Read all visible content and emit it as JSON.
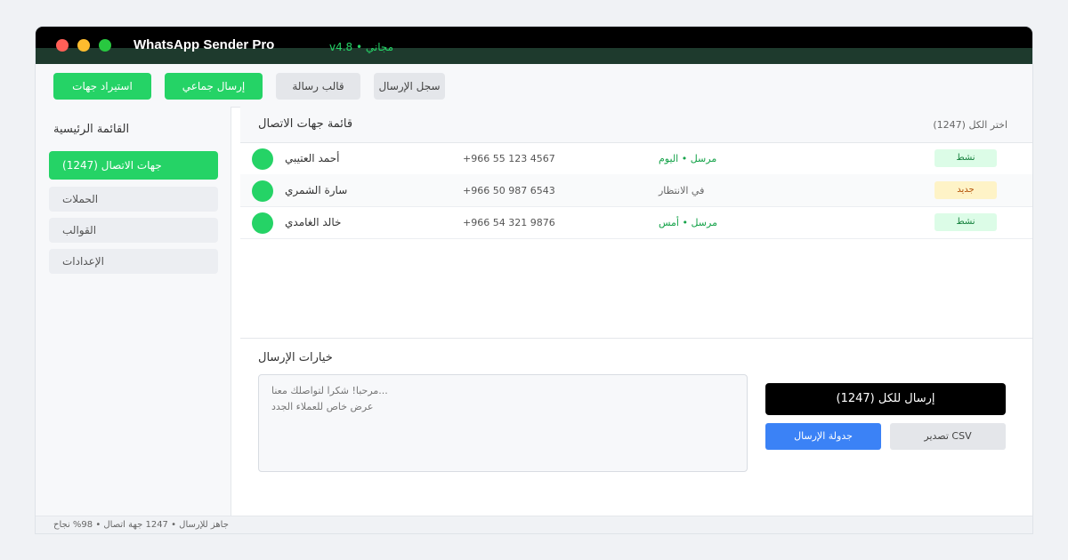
{
  "window": {
    "title": "WhatsApp Sender Pro",
    "version": "v4.8 • مجاني"
  },
  "toolbar": {
    "import_label": "استيراد جهات",
    "bulk_send_label": "إرسال جماعي",
    "template_label": "قالب رسالة",
    "log_label": "سجل الإرسال"
  },
  "sidebar": {
    "title": "القائمة الرئيسية",
    "items": [
      {
        "label": "جهات الاتصال (1247)"
      },
      {
        "label": "الحملات"
      },
      {
        "label": "القوالب"
      },
      {
        "label": "الإعدادات"
      }
    ]
  },
  "contacts": {
    "title": "قائمة جهات الاتصال",
    "select_all": "اختر الكل (1247)",
    "rows": [
      {
        "name": "أحمد العتيبي",
        "phone": "+966 55 123 4567",
        "status": "مرسل • اليوم",
        "badge": "نشط"
      },
      {
        "name": "سارة الشمري",
        "phone": "+966 50 987 6543",
        "status": "في الانتظار",
        "badge": "جديد"
      },
      {
        "name": "خالد الغامدي",
        "phone": "+966 54 321 9876",
        "status": "مرسل • أمس",
        "badge": "نشط"
      }
    ]
  },
  "send_options": {
    "title": "خيارات الإرسال",
    "message_line1": "مرحبا! شكرا لتواصلك معنا...",
    "message_line2": "عرض خاص للعملاء الجدد",
    "send_all_label": "إرسال للكل (1247)",
    "schedule_label": "جدولة الإرسال",
    "export_label": "تصدير CSV"
  },
  "statusbar": {
    "text": "جاهز للإرسال • 1247 جهة اتصال • 98% نجاح"
  },
  "colors": {
    "accent_green": "#25d366",
    "blue": "#3b82f6",
    "titlebar": "#000000"
  }
}
